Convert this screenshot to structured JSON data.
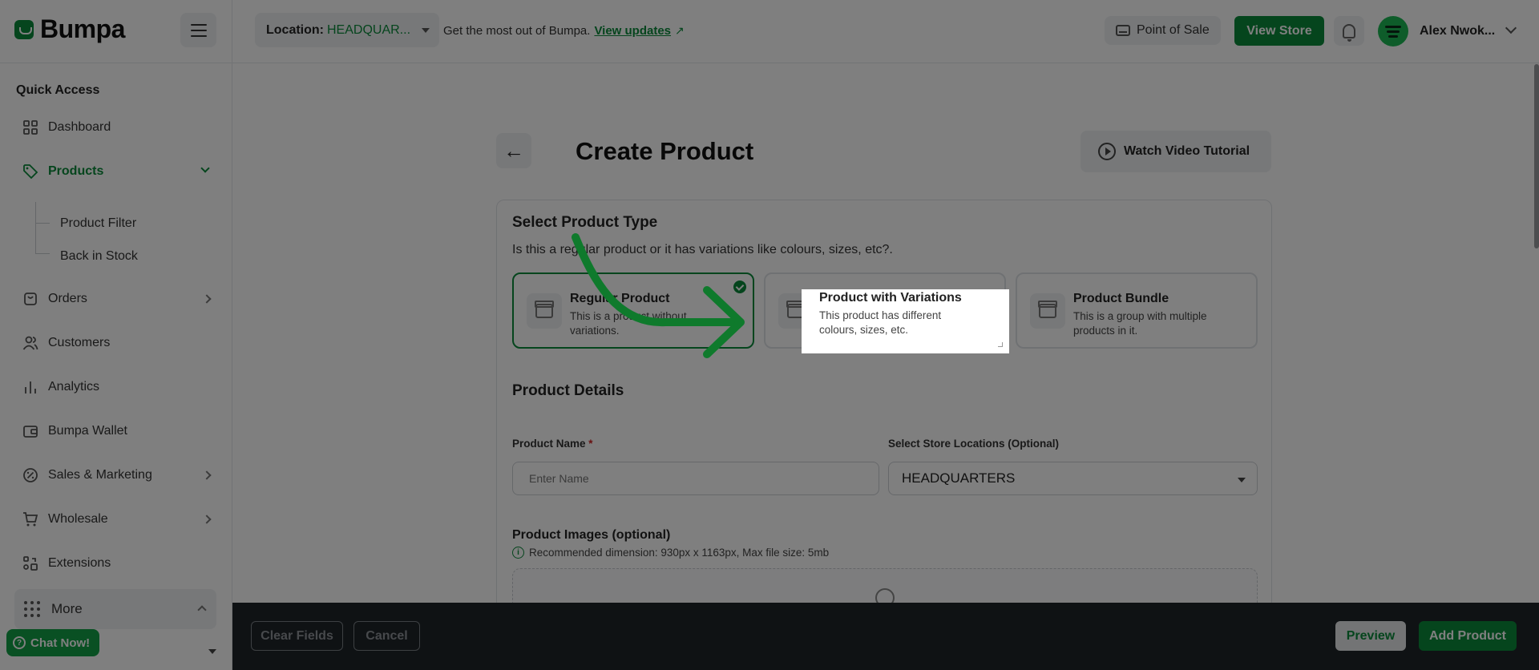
{
  "header": {
    "logo": "Bumpa",
    "location_label": "Location:",
    "location_value": "HEADQUAR...",
    "promo_text": "Get the most out of Bumpa.",
    "promo_link": "View updates",
    "pos_label": "Point of Sale",
    "view_store_label": "View Store",
    "user_name": "Alex Nwok..."
  },
  "sidebar": {
    "title": "Quick Access",
    "items": [
      {
        "label": "Dashboard",
        "icon": "grid-icon"
      },
      {
        "label": "Products",
        "icon": "tag-icon",
        "active": true
      },
      {
        "label": "Orders",
        "icon": "bag-icon"
      },
      {
        "label": "Customers",
        "icon": "users-icon"
      },
      {
        "label": "Analytics",
        "icon": "chart-icon"
      },
      {
        "label": "Bumpa Wallet",
        "icon": "wallet-icon"
      },
      {
        "label": "Sales & Marketing",
        "icon": "percent-icon"
      },
      {
        "label": "Wholesale",
        "icon": "cart-icon"
      },
      {
        "label": "Extensions",
        "icon": "extensions-icon"
      }
    ],
    "sub_items": [
      "Product Filter",
      "Back in Stock"
    ],
    "more_label": "More",
    "chat_label": "Chat Now!"
  },
  "main": {
    "title": "Create Product",
    "video_label": "Watch Video Tutorial",
    "type_section": {
      "title": "Select Product Type",
      "subtitle": "Is this a regular product or it has variations like colours, sizes, etc?.",
      "options": [
        {
          "title": "Regular Product",
          "desc": "This is a product without variations.",
          "selected": true
        },
        {
          "title": "Product with Variations",
          "desc": "This product has different colours, sizes, etc."
        },
        {
          "title": "Product Bundle",
          "desc": "This is a group with multiple products in it."
        }
      ]
    },
    "details": {
      "title": "Product Details",
      "name_label": "Product Name",
      "name_required": "*",
      "name_placeholder": "Enter Name",
      "locations_label": "Select Store Locations (Optional)",
      "locations_value": "HEADQUARTERS",
      "images_title": "Product Images (optional)",
      "images_note": "Recommended dimension: 930px x 1163px, Max file size: 5mb"
    }
  },
  "footer": {
    "clear_label": "Clear Fields",
    "cancel_label": "Cancel",
    "preview_label": "Preview",
    "add_label": "Add Product"
  },
  "colors": {
    "brand": "#0a8a3a",
    "overlay": "rgba(0,0,0,0.5)",
    "footer_bg": "#1e2428"
  }
}
